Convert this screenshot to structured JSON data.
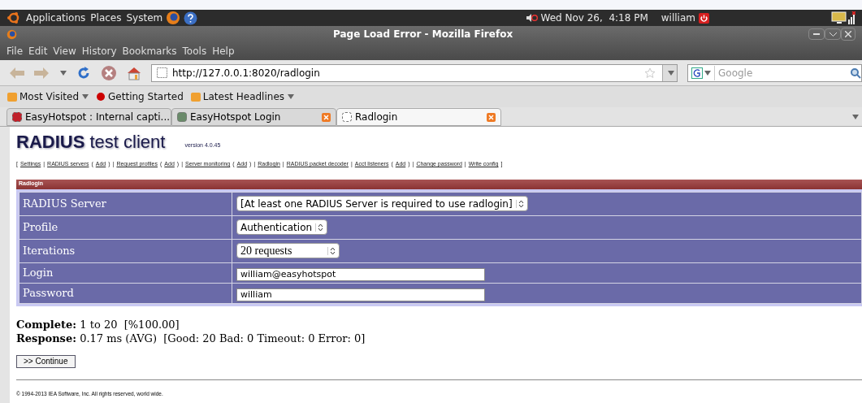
{
  "top_panel": {
    "menus": [
      "Applications",
      "Places",
      "System"
    ],
    "clock": "Wed Nov 26,  4:18 PM",
    "user": "william"
  },
  "window": {
    "title": "Page Load Error - Mozilla Firefox"
  },
  "menu_bar": [
    "File",
    "Edit",
    "View",
    "History",
    "Bookmarks",
    "Tools",
    "Help"
  ],
  "nav_bar": {
    "url": "http://127.0.0.1:8020/radlogin",
    "search_placeholder": "Google"
  },
  "bookmarks": [
    {
      "label": "Most Visited",
      "dropdown": true
    },
    {
      "label": "Getting Started",
      "dropdown": false
    },
    {
      "label": "Latest Headlines",
      "dropdown": true
    }
  ],
  "tabs": [
    {
      "label": "EasyHotspot : Internal capti...",
      "selected": false,
      "color": "#c0202a"
    },
    {
      "label": "EasyHotspot Login",
      "selected": false,
      "color": "#6a8a6a"
    },
    {
      "label": "Radlogin",
      "selected": true,
      "color": "#ffffff"
    }
  ],
  "page": {
    "title_bold": "RADIUS",
    "title_rest": "test client",
    "version": "version 4.0.45",
    "nav": [
      {
        "kind": "text",
        "text": "["
      },
      {
        "kind": "link",
        "text": "Settings"
      },
      {
        "kind": "text",
        "text": "|"
      },
      {
        "kind": "link",
        "text": "RADIUS servers"
      },
      {
        "kind": "text",
        "text": "("
      },
      {
        "kind": "link",
        "text": "Add"
      },
      {
        "kind": "text",
        "text": ")"
      },
      {
        "kind": "text",
        "text": "|"
      },
      {
        "kind": "link",
        "text": "Request profiles"
      },
      {
        "kind": "text",
        "text": "("
      },
      {
        "kind": "link",
        "text": "Add"
      },
      {
        "kind": "text",
        "text": ")"
      },
      {
        "kind": "text",
        "text": "|"
      },
      {
        "kind": "link",
        "text": "Server monitoring"
      },
      {
        "kind": "text",
        "text": "("
      },
      {
        "kind": "link",
        "text": "Add"
      },
      {
        "kind": "text",
        "text": ")"
      },
      {
        "kind": "text",
        "text": "|"
      },
      {
        "kind": "link",
        "text": "Radlogin"
      },
      {
        "kind": "text",
        "text": "|"
      },
      {
        "kind": "link",
        "text": "RADIUS packet decoder"
      },
      {
        "kind": "text",
        "text": "|"
      },
      {
        "kind": "link",
        "text": "Acct listeners"
      },
      {
        "kind": "text",
        "text": "("
      },
      {
        "kind": "link",
        "text": "Add"
      },
      {
        "kind": "text",
        "text": ")"
      },
      {
        "kind": "text",
        "text": "|"
      },
      {
        "kind": "link",
        "text": "Change password"
      },
      {
        "kind": "text",
        "text": "|"
      },
      {
        "kind": "link",
        "text": "Write config"
      },
      {
        "kind": "text",
        "text": "]"
      }
    ],
    "section_title": "Radlogin",
    "rows": [
      {
        "label": "RADIUS Server",
        "kind": "select",
        "value": "[At least one RADIUS Server is required to use radlogin]"
      },
      {
        "label": "Profile",
        "kind": "select",
        "value": "Authentication"
      },
      {
        "label": "Iterations",
        "kind": "select",
        "value": "20 requests"
      },
      {
        "label": "Login",
        "kind": "input",
        "value": "william@easyhotspot"
      },
      {
        "label": "Password",
        "kind": "input",
        "value": "william"
      }
    ],
    "results": [
      {
        "label": "Complete:",
        "value": "1 to 20  [%100.00]"
      },
      {
        "label": "Response:",
        "value": "0.17 ms (AVG)  [Good: 20 Bad: 0 Timeout: 0 Error: 0]"
      }
    ],
    "button": ">> Continue",
    "footer": "© 1994-2013 IEA Software, Inc. All rights reserved, world wide."
  }
}
